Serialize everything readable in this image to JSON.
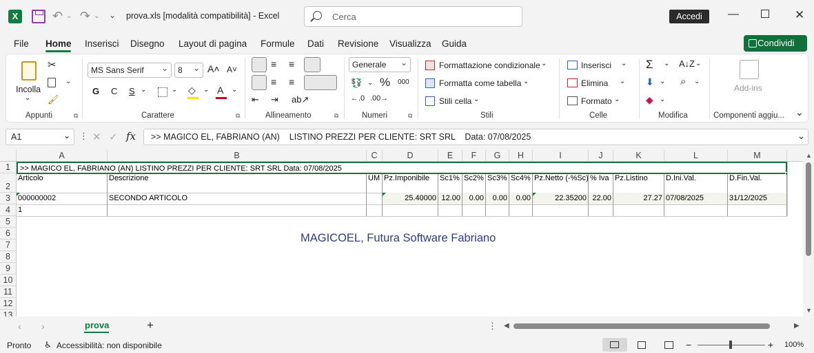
{
  "title": {
    "file": "prova.xls  [modalità compatibilità]  -  Excel",
    "search_placeholder": "Cerca",
    "accedi": "Accedi"
  },
  "menu": {
    "tabs": [
      "File",
      "Home",
      "Inserisci",
      "Disegno",
      "Layout di pagina",
      "Formule",
      "Dati",
      "Revisione",
      "Visualizza",
      "Guida"
    ],
    "active": "Home",
    "share": "Condividi"
  },
  "ribbon": {
    "appunti": {
      "label": "Appunti",
      "paste": "Incolla"
    },
    "carattere": {
      "label": "Carattere",
      "font": "MS Sans Serif",
      "size": "8",
      "bold": "G",
      "italic": "C",
      "underline": "S"
    },
    "allineamento": {
      "label": "Allineamento"
    },
    "numeri": {
      "label": "Numeri",
      "format": "Generale",
      "percent": "%",
      "thousands": "000"
    },
    "stili": {
      "label": "Stili",
      "cond": "Formattazione condizionale",
      "table": "Formatta come tabella",
      "cell": "Stili cella"
    },
    "celle": {
      "label": "Celle",
      "insert": "Inserisci",
      "delete": "Elimina",
      "format": "Formato"
    },
    "modifica": {
      "label": "Modifica"
    },
    "addins": {
      "label": "Componenti aggiu...",
      "btn": "Add-ins"
    }
  },
  "formula": {
    "name_box": "A1",
    "content": ">> MAGICO EL, FABRIANO (AN)    LISTINO PREZZI PER CLIENTE: SRT SRL    Data: 07/08/2025"
  },
  "sheet": {
    "columns": [
      "A",
      "B",
      "C",
      "D",
      "E",
      "F",
      "G",
      "H",
      "I",
      "J",
      "K",
      "L",
      "M"
    ],
    "rows": [
      "1",
      "2",
      "3",
      "4",
      "5",
      "6",
      "7",
      "8",
      "9",
      "10",
      "11",
      "12",
      "13"
    ],
    "r1": ">> MAGICO EL, FABRIANO (AN)     LISTINO PREZZI PER CLIENTE: SRT SRL      Data: 07/08/2025",
    "headers": [
      "Articolo",
      "Descrizione",
      "UM",
      "Pz.Imponibile",
      "Sc1%",
      "Sc2%",
      "Sc3%",
      "Sc4%",
      "Pz.Netto (-%Sc)",
      "% Iva",
      "Pz.Listino",
      "D.Ini.Val.",
      "D.Fin.Val."
    ],
    "row3": [
      "000000002",
      "SECONDO ARTICOLO",
      "",
      "25.40000",
      "12.00",
      "0.00",
      "0.00",
      "0.00",
      "22.35200",
      "22.00",
      "27.27",
      "07/08/2025",
      "31/12/2025"
    ],
    "row4": "1",
    "watermark": "MAGICOEL, Futura Software Fabriano"
  },
  "tabs": {
    "sheet": "prova",
    "add": "+"
  },
  "status": {
    "ready": "Pronto",
    "accessibility": "Accessibilità: non disponibile",
    "zoom": "100%"
  }
}
